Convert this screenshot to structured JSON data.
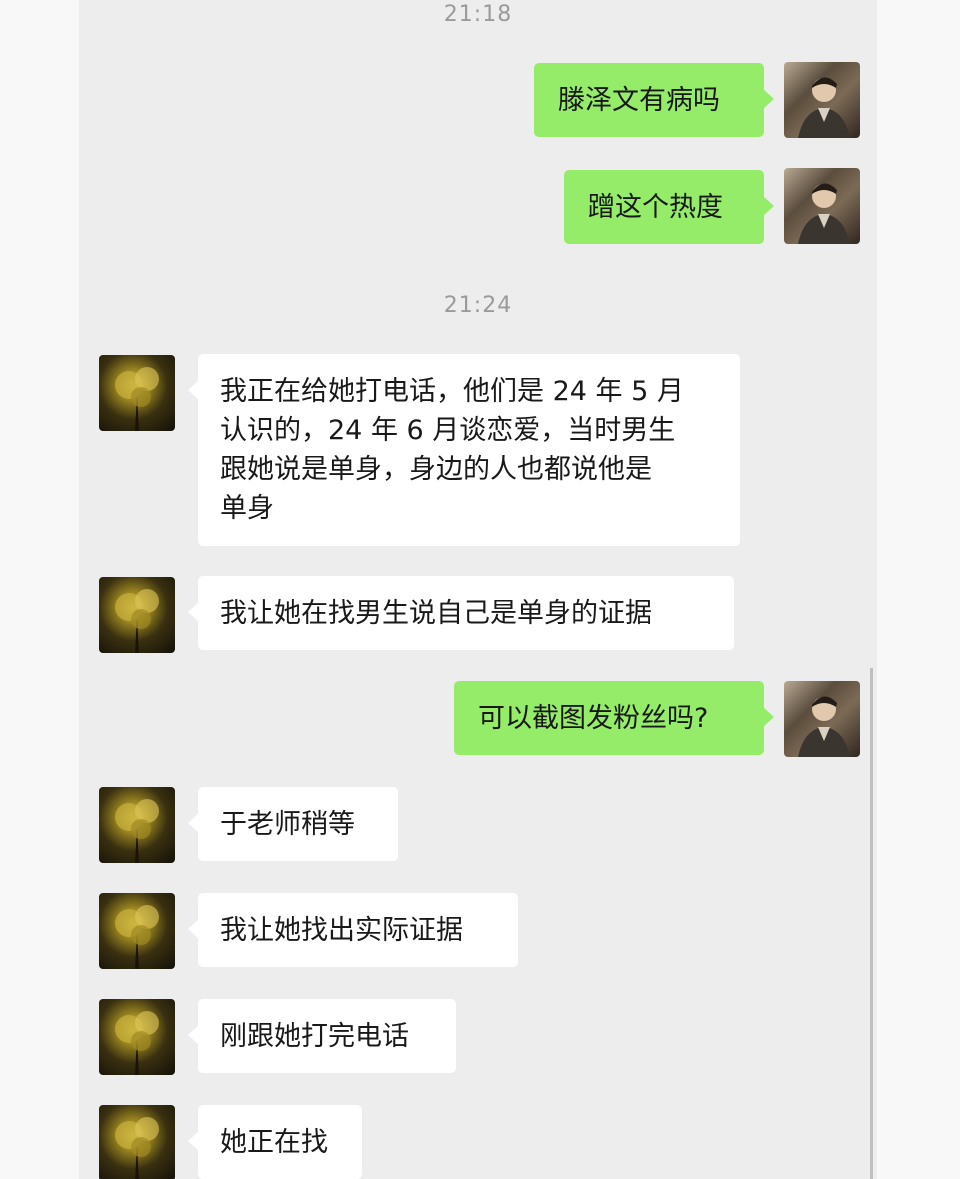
{
  "timestamps": [
    "21:18",
    "21:24"
  ],
  "messages": [
    {
      "sender": "me",
      "text": "滕泽文有病吗"
    },
    {
      "sender": "me",
      "text": "蹭这个热度"
    },
    {
      "sender": "other",
      "text": "我正在给她打电话，他们是 24 年 5 月\n认识的，24 年 6 月谈恋爱，当时男生\n跟她说是单身，身边的人也都说他是\n单身"
    },
    {
      "sender": "other",
      "text": "我让她在找男生说自己是单身的证据"
    },
    {
      "sender": "me",
      "text": "可以截图发粉丝吗?"
    },
    {
      "sender": "other",
      "text": "于老师稍等"
    },
    {
      "sender": "other",
      "text": "我让她找出实际证据"
    },
    {
      "sender": "other",
      "text": "刚跟她打完电话"
    },
    {
      "sender": "other",
      "text": "她正在找"
    }
  ]
}
